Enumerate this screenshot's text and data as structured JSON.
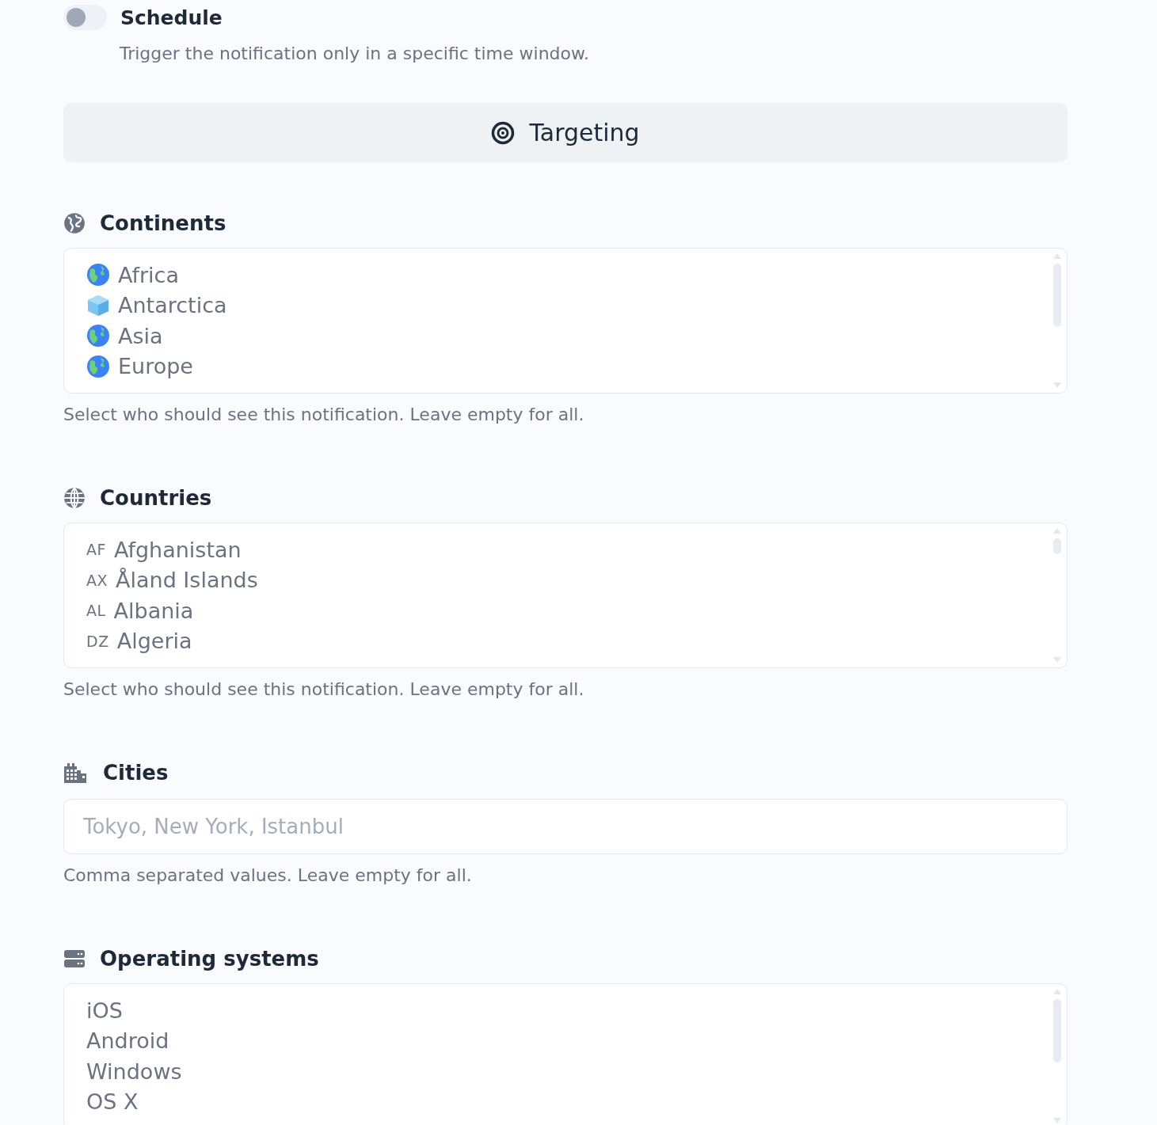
{
  "schedule": {
    "label": "Schedule",
    "on": false,
    "description": "Trigger the notification only in a specific time window."
  },
  "targeting": {
    "title": "Targeting"
  },
  "sections": [
    {
      "kind": "list",
      "title": "Continents",
      "items": [
        {
          "kind": "globe",
          "label": "Africa"
        },
        {
          "kind": "ice",
          "label": "Antarctica"
        },
        {
          "kind": "globe",
          "label": "Asia"
        },
        {
          "kind": "globe",
          "label": "Europe"
        }
      ],
      "help": "Select who should see this notification. Leave empty for all."
    },
    {
      "kind": "list",
      "title": "Countries",
      "items": [
        {
          "kind": "code",
          "code": "AF",
          "label": "Afghanistan"
        },
        {
          "kind": "code",
          "code": "AX",
          "label": "Åland Islands"
        },
        {
          "kind": "code",
          "code": "AL",
          "label": "Albania"
        },
        {
          "kind": "code",
          "code": "DZ",
          "label": "Algeria"
        }
      ],
      "help": "Select who should see this notification. Leave empty for all."
    },
    {
      "kind": "input",
      "title": "Cities",
      "placeholder": "Tokyo, New York, Istanbul",
      "help": "Comma separated values. Leave empty for all."
    },
    {
      "kind": "list",
      "title": "Operating systems",
      "items": [
        {
          "kind": "plain",
          "label": "iOS"
        },
        {
          "kind": "plain",
          "label": "Android"
        },
        {
          "kind": "plain",
          "label": "Windows"
        },
        {
          "kind": "plain",
          "label": "OS X"
        }
      ]
    }
  ]
}
